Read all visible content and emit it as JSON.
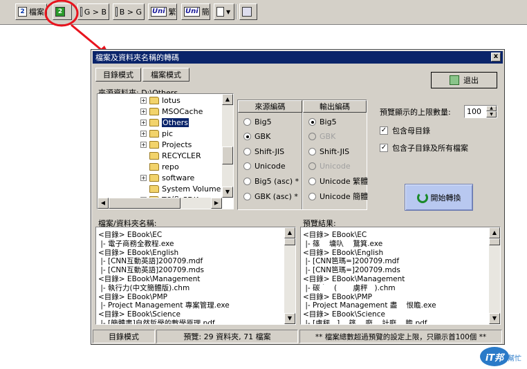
{
  "toolbar": {
    "buttons": [
      {
        "label": "檔案",
        "icon": "file-convert-icon"
      },
      {
        "label": "",
        "icon": "folder-convert-icon"
      },
      {
        "label": "G > B",
        "icon": "document-icon"
      },
      {
        "label": "B > G",
        "icon": "document-icon"
      },
      {
        "label": "繁",
        "icon": "unicode-icon",
        "uni": "Uni"
      },
      {
        "label": "簡",
        "icon": "unicode-icon",
        "uni": "Uni"
      },
      {
        "label": "",
        "icon": "dropdown-document-icon"
      },
      {
        "label": "",
        "icon": "settings-icon"
      }
    ]
  },
  "dialog": {
    "title": "檔案及資料夾名稱的轉碼",
    "close_label": "x",
    "tabs": [
      "目錄模式",
      "檔案模式"
    ],
    "exit_label": "退出",
    "source_path_label": "來源資料夾: D:\\Others",
    "tree": [
      {
        "label": "lotus",
        "expand": true,
        "selected": false
      },
      {
        "label": "MSOCache",
        "expand": true,
        "selected": false
      },
      {
        "label": "Others",
        "expand": true,
        "selected": true
      },
      {
        "label": "pic",
        "expand": true,
        "selected": false
      },
      {
        "label": "Projects",
        "expand": true,
        "selected": false
      },
      {
        "label": "RECYCLER",
        "expand": false,
        "selected": false
      },
      {
        "label": "repo",
        "expand": false,
        "selected": false
      },
      {
        "label": "software",
        "expand": true,
        "selected": false
      },
      {
        "label": "System Volume In",
        "expand": false,
        "selected": false
      },
      {
        "label": "TC組_SDK",
        "expand": true,
        "selected": false
      }
    ],
    "encoding": {
      "source_header": "來源編碼",
      "output_header": "輸出編碼",
      "source_options": [
        {
          "label": "Big5",
          "checked": false,
          "disabled": false
        },
        {
          "label": "GBK",
          "checked": true,
          "disabled": false
        },
        {
          "label": "Shift-JIS",
          "checked": false,
          "disabled": false
        },
        {
          "label": "Unicode",
          "checked": false,
          "disabled": false
        },
        {
          "label": "Big5 (asc) *",
          "checked": false,
          "disabled": false
        },
        {
          "label": "GBK (asc) *",
          "checked": false,
          "disabled": false
        }
      ],
      "output_options": [
        {
          "label": "Big5",
          "checked": true,
          "disabled": false
        },
        {
          "label": "GBK",
          "checked": false,
          "disabled": true
        },
        {
          "label": "Shift-JIS",
          "checked": false,
          "disabled": false
        },
        {
          "label": "Unicode",
          "checked": false,
          "disabled": true
        },
        {
          "label": "Unicode 繁體",
          "checked": false,
          "disabled": false
        },
        {
          "label": "Unicode 簡體",
          "checked": false,
          "disabled": false
        }
      ]
    },
    "preview_limit_label": "預覽顯示的上限數量:",
    "preview_limit_value": "100",
    "include_parent_label": "包含母目錄",
    "include_parent_checked": true,
    "include_children_label": "包含子目錄及所有檔案",
    "include_children_checked": true,
    "start_button_label": "開始轉換",
    "names_list_label": "檔案/資料夾名稱:",
    "names_list": [
      "<目錄> EBook\\EC",
      " |- 電子商務全教程.exe",
      "<目錄> EBook\\English",
      " |- [CNN互動英語]200709.mdf",
      " |- [CNN互動英語]200709.mds",
      "<目錄> EBook\\Management",
      " |- 執行力(中文簡體版).chm",
      "<目錄> EBook\\PMP",
      " |- Project Management 專案管理.exe",
      "<目錄> EBook\\Science",
      " |- [簡體書]自然哲學的數學原理.pdf"
    ],
    "preview_list_label": "預覽結果:",
    "preview_list": [
      "<目錄> EBook\\EC",
      " |- 篠    墉叺    鵞箕.exe",
      "<目錄> EBook\\English",
      " |- [CNN笆瑪=]200709.mdf",
      " |- [CNN笆瑪=]200709.mds",
      "<目錄> EBook\\Management",
      " |- 碳｀   (       虜秤   ).chm",
      "<目錄> EBook\\PMP",
      " |- Project Management 盡    恨瞻.exe",
      "<目錄> EBook\\Science",
      " |- [虜秤   ]    篠    廢    計廢    瞻.pdf"
    ],
    "status": {
      "mode": "目錄模式",
      "counts": "預覽: 29 資料夾, 71 檔案",
      "note": "** 檔案總數超過預覽的設定上限，只顯示首100個 **"
    }
  },
  "watermark": {
    "text": "iT邦",
    "sub": "幫忙"
  },
  "colors": {
    "annotation": "#e8141e",
    "titlebar": "#0a246a",
    "start_button": "#b8c8f0"
  }
}
